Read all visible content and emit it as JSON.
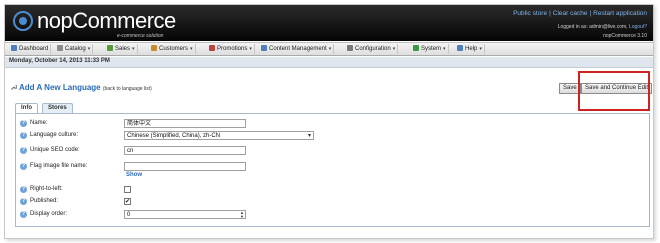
{
  "header": {
    "logo_text": "nopCommerce",
    "tagline": "e-commerce solution",
    "links": [
      "Public store",
      "Clear cache",
      "Restart application"
    ],
    "logged_in_prefix": "Logged in as:",
    "user_email": "admin@live.com",
    "logout": "Logout?",
    "version": "nopCommerce 3.10"
  },
  "menu": {
    "items": [
      {
        "label": "Dashboard",
        "icon": "dashboard-icon",
        "color": "#4a7fc0",
        "has_caret": false
      },
      {
        "label": "Catalog",
        "icon": "catalog-icon",
        "color": "#8a8a8a",
        "has_caret": true
      },
      {
        "label": "Sales",
        "icon": "sales-icon",
        "color": "#5a9a3a",
        "has_caret": true
      },
      {
        "label": "Customers",
        "icon": "customers-icon",
        "color": "#d08a2a",
        "has_caret": true
      },
      {
        "label": "Promotions",
        "icon": "promotions-icon",
        "color": "#c04040",
        "has_caret": true
      },
      {
        "label": "Content Management",
        "icon": "content-icon",
        "color": "#4a7fc0",
        "has_caret": true
      },
      {
        "label": "Configuration",
        "icon": "configuration-icon",
        "color": "#777777",
        "has_caret": true
      },
      {
        "label": "System",
        "icon": "system-icon",
        "color": "#3a9a3a",
        "has_caret": true
      },
      {
        "label": "Help",
        "icon": "help-icon",
        "color": "#4a7fc0",
        "has_caret": true
      }
    ]
  },
  "date_text": "Monday, October 14, 2013 11:33 PM",
  "page": {
    "title": "Add A New Language",
    "back_link": "(back to language list)",
    "save_label": "Save",
    "save_continue_label": "Save and Continue Edit"
  },
  "tabs": [
    "Info",
    "Stores"
  ],
  "form": {
    "name_label": "Name:",
    "name_value": "简体中文",
    "culture_label": "Language culture:",
    "culture_value": "Chinese (Simplified, China), zh-CN",
    "seo_label": "Unique SEO code:",
    "seo_value": "cn",
    "flag_label": "Flag image file name:",
    "flag_value": "",
    "show_link": "Show",
    "rtl_label": "Right-to-left:",
    "rtl_checked": false,
    "published_label": "Published:",
    "published_checked": true,
    "order_label": "Display order:",
    "order_value": "0"
  },
  "colors": {
    "accent": "#2a6cb8",
    "highlight": "#cc2222",
    "topbar": "#111111"
  }
}
